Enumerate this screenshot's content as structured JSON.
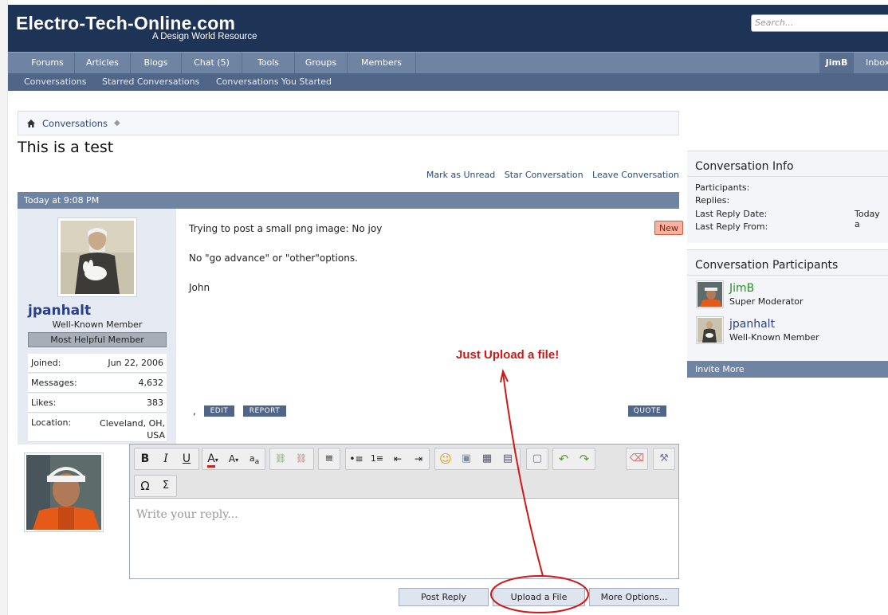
{
  "header": {
    "site_title": "Electro-Tech-Online.com",
    "site_subtitle": "A Design World Resource",
    "search_placeholder": "Search..."
  },
  "nav": {
    "tabs": [
      "Forums",
      "Articles",
      "Blogs",
      "Chat (5)",
      "Tools",
      "Groups",
      "Members"
    ],
    "user": "JimB",
    "inbox": "Inbox"
  },
  "subnav": [
    "Conversations",
    "Starred Conversations",
    "Conversations You Started"
  ],
  "breadcrumb": {
    "label": "Conversations"
  },
  "page_title": "This is a test",
  "actions": [
    "Mark as Unread",
    "Star Conversation",
    "Leave Conversation"
  ],
  "message": {
    "timestamp": "Today at 9:08 PM",
    "username": "jpanhalt",
    "user_title": "Well-Known Member",
    "banner": "Most Helpful Member",
    "info": [
      {
        "label": "Joined:",
        "value": "Jun 22, 2006"
      },
      {
        "label": "Messages:",
        "value": "4,632"
      },
      {
        "label": "Likes:",
        "value": "383"
      },
      {
        "label": "Location:",
        "value": "Cleveland, OH, USA"
      }
    ],
    "lines": [
      "Trying to post a small png image: No joy",
      "No \"go advance\" or \"other\"options.",
      "John"
    ],
    "new_badge": "New",
    "comma": ",",
    "edit": "EDIT",
    "report": "REPORT",
    "quote": "QUOTE"
  },
  "annotation": "Just Upload a file!",
  "editor": {
    "placeholder": "Write your reply..."
  },
  "buttons": {
    "post_reply": "Post Reply",
    "upload": "Upload a File",
    "more": "More Options..."
  },
  "sidebar": {
    "info_title": "Conversation Info",
    "info_rows": [
      {
        "label": "Participants:",
        "value": ""
      },
      {
        "label": "Replies:",
        "value": ""
      },
      {
        "label": "Last Reply Date:",
        "value": "Today a"
      },
      {
        "label": "Last Reply From:",
        "value": ""
      }
    ],
    "participants_title": "Conversation Participants",
    "participants": [
      {
        "name": "JimB",
        "title": "Super Moderator"
      },
      {
        "name": "jpanhalt",
        "title": "Well-Known Member"
      }
    ],
    "invite": "Invite More"
  },
  "colors": {
    "header_bg": "#1d3456",
    "nav_bg": "#6f84a3",
    "subnav_bg": "#4f6688",
    "annotation_red": "#d01818",
    "moderator_green": "#2e8b2e"
  }
}
